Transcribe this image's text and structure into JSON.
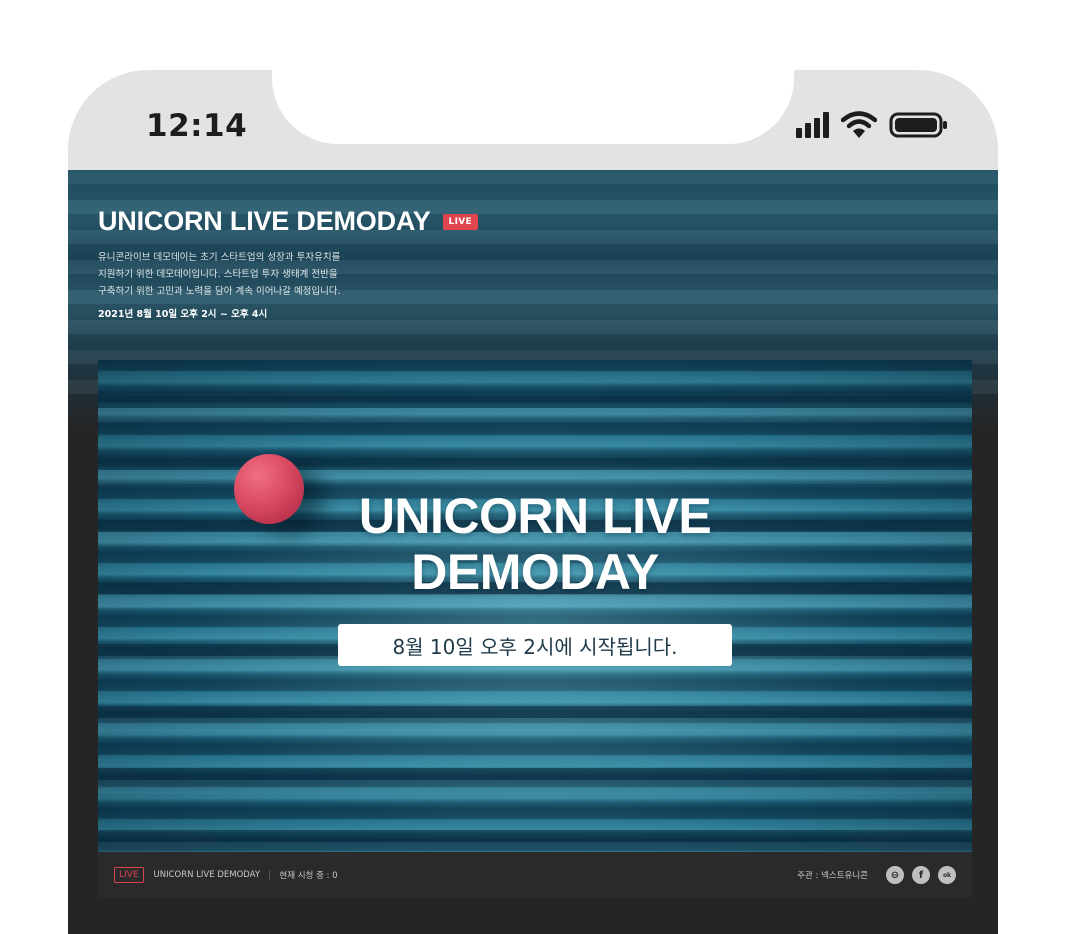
{
  "status_bar": {
    "time": "12:14",
    "icons": [
      "cellular-signal-icon",
      "wifi-icon",
      "battery-icon"
    ]
  },
  "header": {
    "title": "UNICORN LIVE DEMODAY",
    "live_badge": "LIVE",
    "description": [
      "유니콘라이브 데모데이는 초기 스타트업의 성장과 투자유치를",
      "지원하기 위한 데모데이입니다. 스타트업 투자 생태계 전반을",
      "구축하기 위한 고민과 노력을 담아 계속 이어나갈 예정입니다."
    ],
    "date": "2021년 8월 10일 오후 2시 ~ 오후 4시"
  },
  "video": {
    "title_line1": "UNICORN LIVE",
    "title_line2": "DEMODAY",
    "start_notice": "8월 10일 오후 2시에 시작됩니다."
  },
  "player_bar": {
    "live_label": "LIVE",
    "stream_title": "UNICORN LIVE DEMODAY",
    "separator": "|",
    "viewers": "현재 시청 중 : 0",
    "host": "주관 : 넥스트유니콘",
    "buttons": [
      "link-icon",
      "facebook-icon",
      "kakao-icon"
    ],
    "button_glyphs": [
      "⊖",
      "f",
      "ok"
    ]
  },
  "colors": {
    "live_red": "#e0454f",
    "hero_ball": "#d94a62",
    "screen_bg": "#252525",
    "header_bg": "#1f4e62"
  }
}
